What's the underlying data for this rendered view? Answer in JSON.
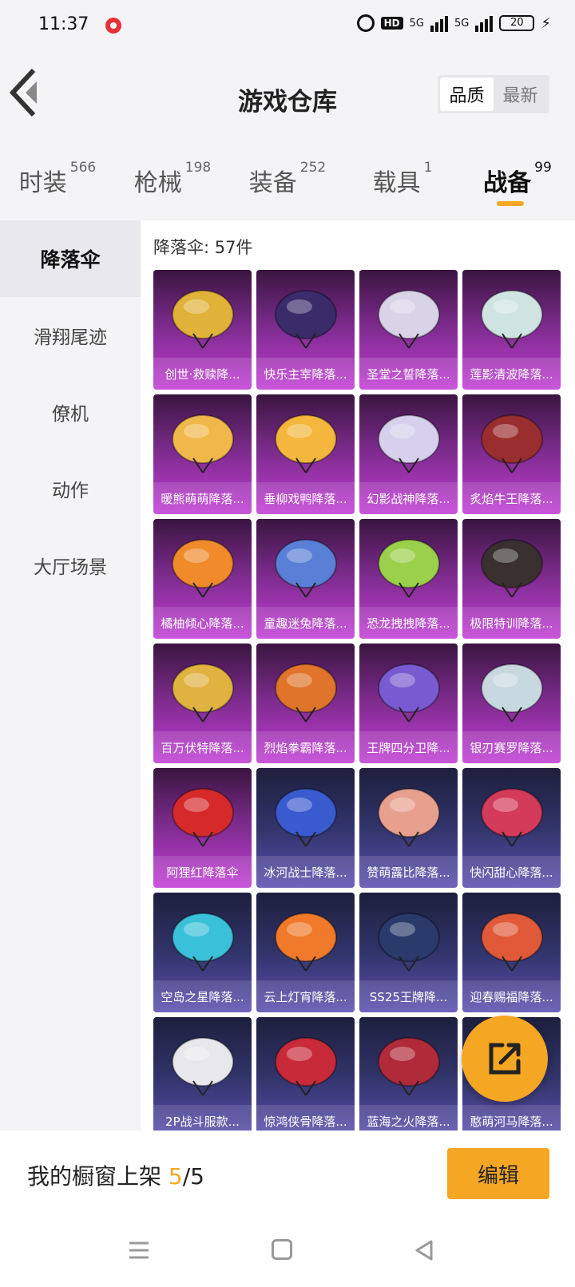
{
  "status_bar": {
    "time": "11:37",
    "hd_label": "HD",
    "net_label_1": "5G",
    "net_label_2": "5G",
    "battery": "20"
  },
  "header": {
    "title": "游戏仓库",
    "sort_options": [
      "品质",
      "最新"
    ],
    "active_sort": "品质"
  },
  "tabs": [
    {
      "label": "时装",
      "count": "566",
      "active": false
    },
    {
      "label": "枪械",
      "count": "198",
      "active": false
    },
    {
      "label": "装备",
      "count": "252",
      "active": false
    },
    {
      "label": "载具",
      "count": "1",
      "active": false
    },
    {
      "label": "战备",
      "count": "99",
      "active": true
    }
  ],
  "sidebar": {
    "items": [
      {
        "label": "降落伞",
        "active": true
      },
      {
        "label": "滑翔尾迹",
        "active": false
      },
      {
        "label": "僚机",
        "active": false
      },
      {
        "label": "动作",
        "active": false
      },
      {
        "label": "大厅场景",
        "active": false
      }
    ]
  },
  "grid": {
    "count_label": "降落伞: 57件",
    "items": [
      {
        "name": "创世·救赎降...",
        "tier": "purple",
        "color": "#e0b23a"
      },
      {
        "name": "快乐主宰降落...",
        "tier": "purple",
        "color": "#3a2b6a"
      },
      {
        "name": "圣堂之誓降落...",
        "tier": "purple",
        "color": "#d9d3e8"
      },
      {
        "name": "莲影清波降落...",
        "tier": "purple",
        "color": "#cfe3e0"
      },
      {
        "name": "暖熊萌萌降落...",
        "tier": "purple",
        "color": "#f0b84a"
      },
      {
        "name": "垂柳戏鸭降落...",
        "tier": "purple",
        "color": "#f4b63c"
      },
      {
        "name": "幻影战神降落...",
        "tier": "purple",
        "color": "#d6d0ec"
      },
      {
        "name": "炙焰牛王降落...",
        "tier": "purple",
        "color": "#9a2e2e"
      },
      {
        "name": "橘柚倾心降落...",
        "tier": "purple",
        "color": "#f08a2a"
      },
      {
        "name": "童趣迷兔降落...",
        "tier": "purple",
        "color": "#5a7fd6"
      },
      {
        "name": "恐龙拽拽降落...",
        "tier": "purple",
        "color": "#9ad04a"
      },
      {
        "name": "极限特训降落...",
        "tier": "purple",
        "color": "#3a3030"
      },
      {
        "name": "百万伏特降落...",
        "tier": "purple",
        "color": "#e0b240"
      },
      {
        "name": "烈焰拳霸降落...",
        "tier": "purple",
        "color": "#e0742a"
      },
      {
        "name": "王牌四分卫降...",
        "tier": "purple",
        "color": "#7a5ad0"
      },
      {
        "name": "银刃赛罗降落...",
        "tier": "purple",
        "color": "#c8d8e0"
      },
      {
        "name": "阿狸红降落伞",
        "tier": "purple",
        "color": "#d62a2a"
      },
      {
        "name": "冰河战士降落...",
        "tier": "blue",
        "color": "#3a5ad0"
      },
      {
        "name": "赞萌露比降落...",
        "tier": "blue",
        "color": "#e8a08e"
      },
      {
        "name": "快闪甜心降落...",
        "tier": "blue",
        "color": "#d43a5a"
      },
      {
        "name": "空岛之星降落...",
        "tier": "blue",
        "color": "#3ac0d8"
      },
      {
        "name": "云上灯宵降落...",
        "tier": "blue",
        "color": "#f07a2a"
      },
      {
        "name": "SS25王牌降...",
        "tier": "blue",
        "color": "#2a3a6a"
      },
      {
        "name": "迎春赐福降落...",
        "tier": "blue",
        "color": "#e05a3a"
      },
      {
        "name": "2P战斗服款...",
        "tier": "blue",
        "color": "#e8e8ec"
      },
      {
        "name": "惊鸿侠骨降落...",
        "tier": "blue",
        "color": "#c82a3a"
      },
      {
        "name": "蓝海之火降落...",
        "tier": "blue",
        "color": "#b02a3a"
      },
      {
        "name": "憨萌河马降落...",
        "tier": "blue",
        "color": "#e0c8b0"
      }
    ]
  },
  "bottom_bar": {
    "showcase_prefix": "我的橱窗上架 ",
    "showcase_current": "5",
    "showcase_total": "/5",
    "edit_label": "编辑"
  },
  "colors": {
    "accent": "#f5a623",
    "purple_tier": "#c23fd6",
    "blue_tier": "#5b4fb0"
  }
}
